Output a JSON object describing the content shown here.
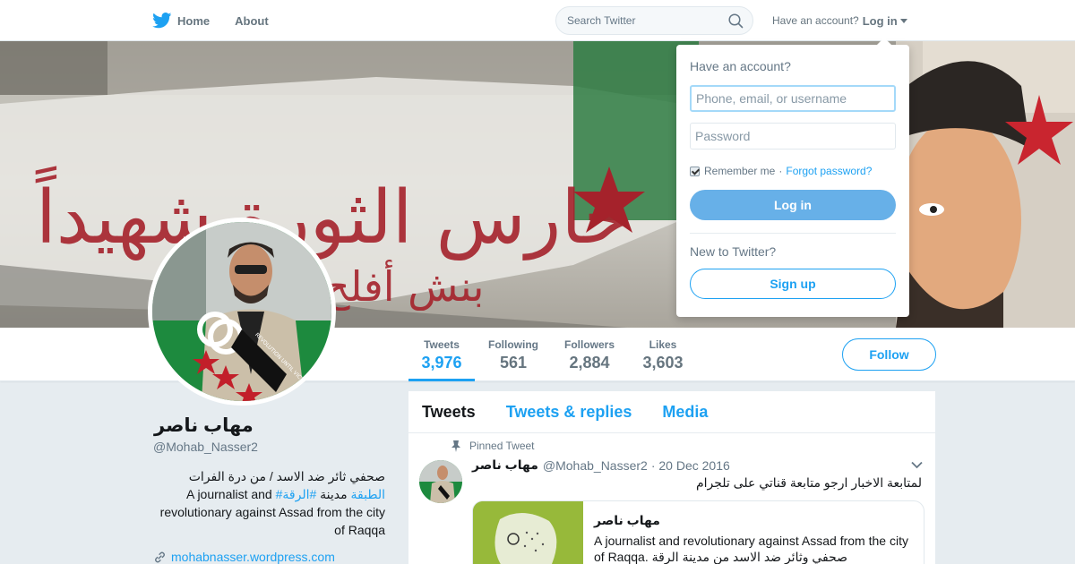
{
  "nav": {
    "home_label": "Home",
    "about_label": "About",
    "search_placeholder": "Search Twitter",
    "have_account_text": "Have an account?",
    "login_label": "Log in"
  },
  "colors": {
    "accent": "#1da1f2",
    "login_button": "#67b0e8",
    "page_bg": "#e6ecf0"
  },
  "banner": {
    "wall_text_main": "حارس الثورة شهيداً",
    "wall_text_sub": "بنش  أفلح ال"
  },
  "avatar": {
    "badge_text": "REVOLUTION UNTIL VICTORY"
  },
  "profile": {
    "name": "مهاب ناصر",
    "handle": "@Mohab_Nasser2",
    "bio_line1": "صحفي ثائر ضد الاسد / من درة الفرات",
    "bio_hash1": "#الرقة",
    "bio_mid": "مدينة",
    "bio_hash2": "#الطبقة",
    "bio_en": "A journalist and revolutionary against Assad from the city of Raqqa",
    "bio_en_part1": "A journalist and",
    "bio_en_part2": "revolutionary against Assad from the city of Raqqa",
    "website": "mohabnasser.wordpress.com"
  },
  "stats": [
    {
      "label": "Tweets",
      "value": "3,976"
    },
    {
      "label": "Following",
      "value": "561"
    },
    {
      "label": "Followers",
      "value": "2,884"
    },
    {
      "label": "Likes",
      "value": "3,603"
    }
  ],
  "follow_label": "Follow",
  "timeline": {
    "tabs": [
      "Tweets",
      "Tweets & replies",
      "Media"
    ],
    "pinned_label": "Pinned Tweet",
    "tweet": {
      "name": "مهاب ناصر",
      "handle": "@Mohab_Nasser2",
      "date": "· 20 Dec 2016",
      "text": "لمتابعة الاخبار ارجو متابعة قناتي على تلجرام",
      "card_title": "مهاب ناصر",
      "card_desc": "A journalist and revolutionary against Assad from the city of Raqqa. صحفي وثائر ضد الاسد من مدينة الرقة"
    }
  },
  "login_dropdown": {
    "title": "Have an account?",
    "username_placeholder": "Phone, email, or username",
    "password_placeholder": "Password",
    "remember_label": "Remember me",
    "separator": "·",
    "forgot_label": "Forgot password?",
    "login_button": "Log in",
    "new_label": "New to Twitter?",
    "signup_button": "Sign up"
  }
}
